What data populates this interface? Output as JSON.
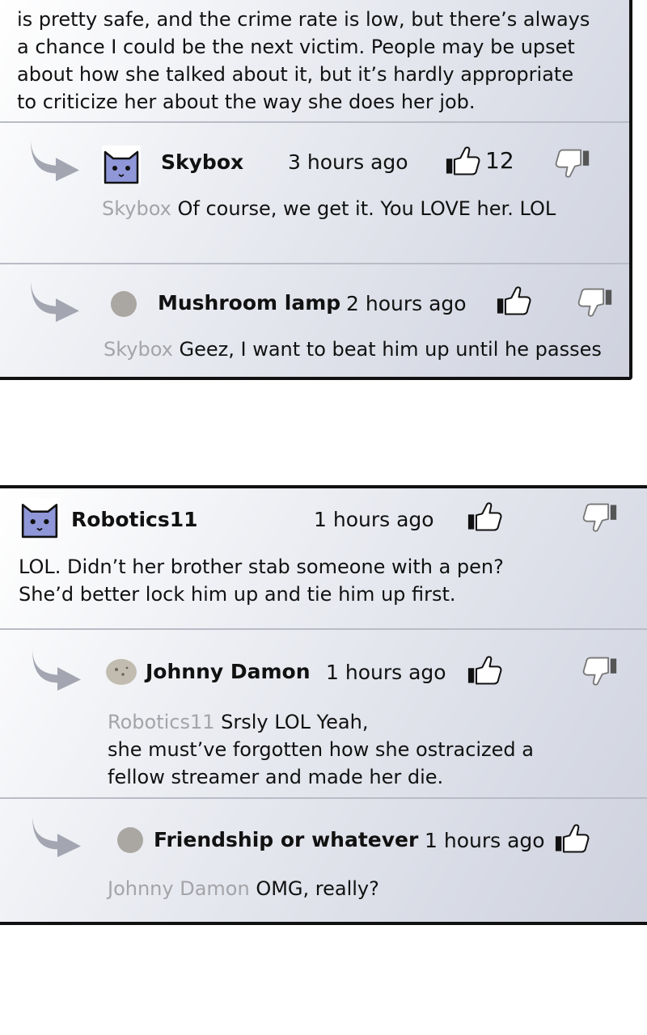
{
  "top_panel": {
    "post_text_lines": [
      "is pretty safe, and the crime rate is low, but there’s always",
      "a chance I could be the next victim. People may be upset",
      "about how she talked about it, but it’s hardly appropriate",
      "to criticize her about the way she does her job."
    ],
    "replies": [
      {
        "username": "Skybox",
        "time": "3 hours ago",
        "like_count": "12",
        "reply_to": "Skybox",
        "text": "Of course, we get it. You LOVE her. LOL"
      },
      {
        "username": "Mushroom lamp",
        "time": "2 hours ago",
        "reply_to": "Skybox",
        "text": "Geez, I want to beat him up until he passes"
      }
    ]
  },
  "bottom_panel": {
    "post": {
      "username": "Robotics11",
      "time": "1 hours ago",
      "text_lines": [
        "LOL. Didn’t her brother stab someone with a pen?",
        "She’d better lock him up and tie him up first."
      ]
    },
    "replies": [
      {
        "username": "Johnny Damon",
        "time": "1 hours ago",
        "reply_to": "Robotics11",
        "text_first": "Srsly LOL Yeah,",
        "text_lines": [
          "she must’ve forgotten how she ostracized a",
          "fellow streamer and made her die."
        ]
      },
      {
        "username": "Friendship or whatever",
        "time": "1 hours ago",
        "reply_to": "Johnny Damon",
        "text": "OMG, really?"
      }
    ]
  },
  "icons": {
    "reply_arrow": "reply-arrow-icon",
    "like": "thumbs-up-icon",
    "dislike": "thumbs-down-icon",
    "avatar_cat": "cat-avatar-icon"
  },
  "colors": {
    "panel_gradient_end": "#cfd2de",
    "reply_to_gray": "#a4a4a8",
    "avatar_cat": "#8f97d8"
  }
}
